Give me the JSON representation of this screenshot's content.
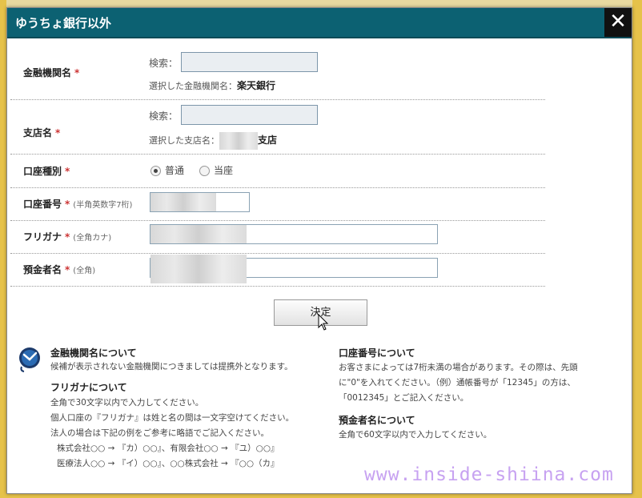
{
  "dialog": {
    "title": "ゆうちょ銀行以外",
    "close_label": "✕"
  },
  "form": {
    "bank": {
      "label": "金融機関名",
      "required_mark": "*",
      "search_label": "検索：",
      "search_value": "",
      "selected_prefix": "選択した金融機関名：",
      "selected_value": "楽天銀行"
    },
    "branch": {
      "label": "支店名",
      "required_mark": "*",
      "search_label": "検索：",
      "search_value": "",
      "selected_prefix": "選択した支店名：",
      "selected_value": "支店"
    },
    "account_type": {
      "label": "口座種別",
      "required_mark": "*",
      "options": [
        "普通",
        "当座"
      ],
      "selected": "普通"
    },
    "account_number": {
      "label": "口座番号",
      "required_mark": "*",
      "note": "(半角英数字7桁)"
    },
    "furigana": {
      "label": "フリガナ",
      "required_mark": "*",
      "note": "(全角カナ)"
    },
    "holder": {
      "label": "預金者名",
      "required_mark": "*",
      "note": "(全角)"
    },
    "submit_label": "決定"
  },
  "info": {
    "bank_title": "金融機関名について",
    "bank_text": "候補が表示されない金融機関につきましては提携外となります。",
    "furigana_title": "フリガナについて",
    "furigana_lines": [
      "全角で30文字以内で入力してください。",
      "個人口座の『フリガナ』は姓と名の間は一文字空けてください。",
      "法人の場合は下記の例をご参考に略語でご記入ください。",
      "株式会社○○ → 『カ）○○』、有限会社○○ → 『ユ）○○』",
      "医療法人○○ → 『イ）○○』、○○株式会社 → 『○○（カ』"
    ],
    "account_title": "口座番号について",
    "account_lines": [
      "お客さまによっては7桁未満の場合があります。その際は、先頭",
      "に\"0\"を入れてください。（例）通帳番号が「12345」の方は、",
      "「0012345」とご記入ください。"
    ],
    "holder_title": "預金者名について",
    "holder_text": "全角で60文字以内で入力してください。"
  },
  "watermark": "www.inside-shiina.com",
  "colors": {
    "titlebar": "#0c6172",
    "required": "#cc3333"
  }
}
